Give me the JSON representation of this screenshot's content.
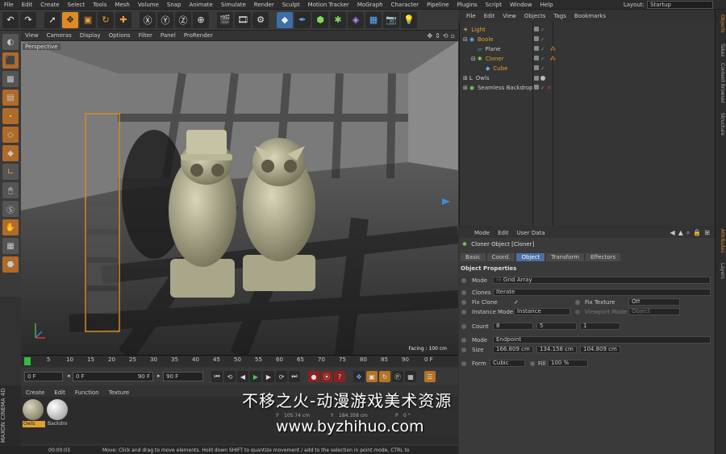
{
  "menubar": {
    "items": [
      "File",
      "Edit",
      "Create",
      "Select",
      "Tools",
      "Mesh",
      "Volume",
      "Snap",
      "Animate",
      "Simulate",
      "Render",
      "Sculpt",
      "Motion Tracker",
      "MoGraph",
      "Character",
      "Pipeline",
      "Plugins",
      "Script",
      "Window",
      "Help"
    ],
    "layout_label": "Layout:",
    "layout_value": "Startup"
  },
  "viewport": {
    "menu": [
      "View",
      "Cameras",
      "Display",
      "Options",
      "Filter",
      "Panel",
      "ProRender"
    ],
    "label": "Perspective",
    "facing": "Facing : 100 cm"
  },
  "timeline": {
    "ticks": [
      "0",
      "5",
      "10",
      "15",
      "20",
      "25",
      "30",
      "35",
      "40",
      "45",
      "50",
      "55",
      "60",
      "65",
      "70",
      "75",
      "80",
      "85",
      "90"
    ],
    "end_frame": "0 F",
    "start_field": "0 F",
    "min_field": "0 F",
    "max_field": "90 F",
    "end_field": "90 F"
  },
  "material_manager": {
    "menu": [
      "Create",
      "Edit",
      "Function",
      "Texture"
    ],
    "materials": [
      {
        "name": "Owls",
        "selected": true
      },
      {
        "name": "Backdro",
        "selected": false
      }
    ]
  },
  "coords": {
    "y_size": "105.74 cm",
    "y_pos": "184.358 cm",
    "p": "0 °"
  },
  "maxon": "MAXON CINEMA 4D",
  "status": {
    "time": "00:00:03",
    "message": "Move: Click and drag to move elements. Hold down SHIFT to quantize movement / add to the selection in point mode, CTRL to"
  },
  "object_manager": {
    "menu": [
      "File",
      "Edit",
      "View",
      "Objects",
      "Tags",
      "Bookmarks"
    ],
    "objects": [
      {
        "name": "Light",
        "indent": 0,
        "color": "#e0a030"
      },
      {
        "name": "Boole",
        "indent": 0,
        "color": "#e0a030"
      },
      {
        "name": "Plane",
        "indent": 1,
        "color": "#dddddd"
      },
      {
        "name": "Cloner",
        "indent": 1,
        "color": "#e0a030"
      },
      {
        "name": "Cube",
        "indent": 2,
        "color": "#e0a030"
      },
      {
        "name": "Owls",
        "indent": 0,
        "color": "#dddddd"
      },
      {
        "name": "Seamless Backdrop",
        "indent": 0,
        "color": "#dddddd"
      }
    ]
  },
  "attributes": {
    "menu": [
      "Mode",
      "Edit",
      "User Data"
    ],
    "title": "Cloner Object [Cloner]",
    "tabs": [
      "Basic",
      "Coord.",
      "Object",
      "Transform",
      "Effectors"
    ],
    "active_tab": "Object",
    "section": "Object Properties",
    "mode_label": "Mode",
    "mode_value": "Grid Array",
    "clones_label": "Clones",
    "clones_value": "Iterate",
    "fix_clone_label": "Fix Clone",
    "fix_clone_check": "✓",
    "fix_texture_label": "Fix Texture",
    "fix_texture_value": "Off",
    "instance_mode_label": "Instance Mode",
    "instance_mode_value": "Instance",
    "viewport_mode_label": "Viewport Mode",
    "viewport_mode_value": "Object",
    "count_label": "Count",
    "count": [
      "8",
      "5",
      "1"
    ],
    "mode2_label": "Mode",
    "mode2_value": "Endpoint",
    "size_label": "Size",
    "size": [
      "166.809 cm",
      "134.158 cm",
      "104.809 cm"
    ],
    "form_label": "Form",
    "form_value": "Cubic",
    "fill_label": "Fill",
    "fill_value": "100 %"
  },
  "edge_tabs": [
    "Objects",
    "Takes",
    "Content Browser",
    "Structure",
    "Attributes",
    "Layers"
  ],
  "watermark": {
    "cn": "不移之火-动漫游戏美术资源",
    "url": "www.byzhihuo.com"
  }
}
